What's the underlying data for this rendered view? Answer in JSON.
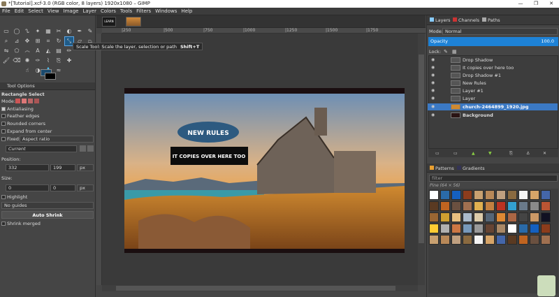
{
  "window": {
    "title": "*[Tutorial].xcf-3.0 (RGB color, 8 layers) 1920x1080 – GIMP",
    "minimize": "—",
    "maximize": "❐",
    "close": "✕"
  },
  "menu": [
    "File",
    "Edit",
    "Select",
    "View",
    "Image",
    "Layer",
    "Colors",
    "Tools",
    "Filters",
    "Windows",
    "Help"
  ],
  "tooltip": {
    "text": "Scale Tool: Scale the layer, selection or path",
    "shortcut": "Shift+T"
  },
  "tool_options": {
    "tab": "Tool Options",
    "tool_name": "Rectangle Select",
    "mode_label": "Mode:",
    "antialiasing": "Antialiasing",
    "feather": "Feather edges",
    "rounded": "Rounded corners",
    "expand": "Expand from center",
    "fixed_label": "Fixed:",
    "fixed_value": "Aspect ratio",
    "current": "Current",
    "position_label": "Position:",
    "pos_x": "332",
    "pos_y": "199",
    "pos_unit": "px",
    "size_label": "Size:",
    "size_w": "0",
    "size_h": "0",
    "size_unit": "px",
    "highlight": "Highlight",
    "guides": "No guides",
    "auto_shrink": "Auto Shrink",
    "shrink_merged": "Shrink merged"
  },
  "tabs_thumbs": [
    "LEARN"
  ],
  "ruler_ticks": [
    "|250",
    "|500",
    "|750",
    "|1000",
    "|1250",
    "|1500",
    "|1750"
  ],
  "image": {
    "badge1": "NEW RULES",
    "badge2": "IT COPIES OVER HERE TOO"
  },
  "layers_panel": {
    "tabs": [
      "Layers",
      "Channels",
      "Paths"
    ],
    "mode_label": "Mode:",
    "mode_value": "Normal",
    "opacity_label": "Opacity",
    "opacity_value": "100.0",
    "lock_label": "Lock:",
    "layers": [
      {
        "name": "Drop Shadow",
        "active": false
      },
      {
        "name": "It copies over here too",
        "active": false
      },
      {
        "name": "Drop Shadow #1",
        "active": false
      },
      {
        "name": "New Rules",
        "active": false
      },
      {
        "name": "Layer #1",
        "active": false
      },
      {
        "name": "Layer",
        "active": false
      },
      {
        "name": "church-2464899_1920.jpg",
        "active": true
      },
      {
        "name": "Background",
        "active": false
      }
    ]
  },
  "patterns_panel": {
    "tabs": [
      "Patterns",
      "Gradients"
    ],
    "filter": "filter",
    "size_label": "Pine (64 × 56)"
  },
  "colors": {
    "accent": "#1f5b88",
    "active_layer": "#3b79c4",
    "opacity_bar": "#1e82d6"
  }
}
